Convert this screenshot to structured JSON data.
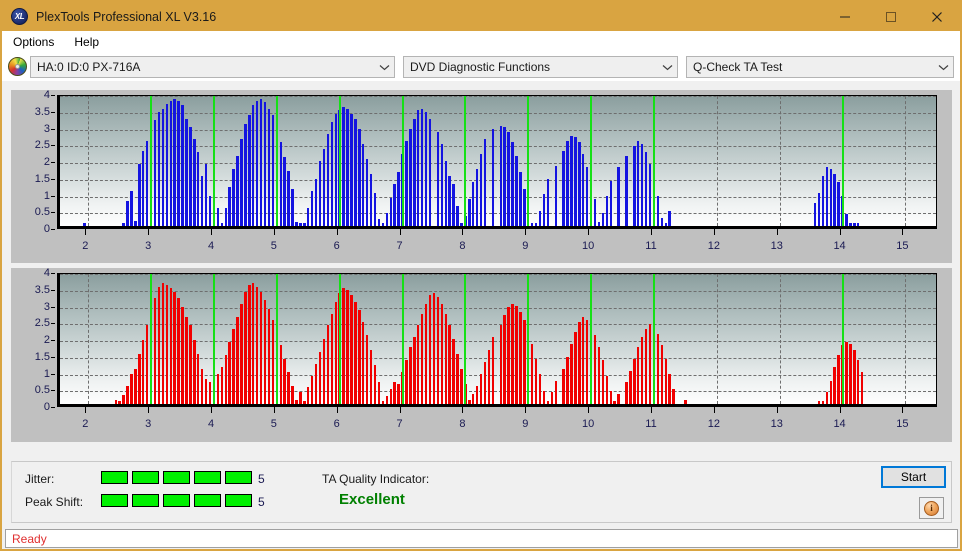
{
  "window": {
    "title": "PlexTools Professional XL V3.16",
    "app_icon": "xl-logo-icon",
    "minimize_label": "minimize-icon",
    "maximize_label": "maximize-icon",
    "close_label": "close-icon",
    "titlebar_color": "#d9a441"
  },
  "menu": {
    "items": [
      {
        "label": "Options"
      },
      {
        "label": "Help"
      }
    ]
  },
  "toolbar": {
    "drive_icon": "disc-icon",
    "drive_select": {
      "value": "HA:0 ID:0  PX-716A",
      "options": [
        "HA:0 ID:0  PX-716A"
      ]
    },
    "function_select": {
      "value": "DVD Diagnostic Functions",
      "options": [
        "DVD Diagnostic Functions"
      ]
    },
    "test_select": {
      "value": "Q-Check TA Test",
      "options": [
        "Q-Check TA Test"
      ]
    }
  },
  "results": {
    "jitter_label": "Jitter:",
    "jitter_value": "5",
    "jitter_segments_on": 5,
    "jitter_segments_total": 5,
    "peak_shift_label": "Peak Shift:",
    "peak_shift_value": "5",
    "peak_shift_segments_on": 5,
    "peak_shift_segments_total": 5,
    "ta_quality_label": "TA Quality Indicator:",
    "ta_quality_value": "Excellent",
    "ta_quality_color": "#008000",
    "meter_color": "#00f000",
    "start_button": "Start",
    "info_button": "i"
  },
  "status": {
    "text": "Ready",
    "color": "#e03030"
  },
  "chart_data": [
    {
      "type": "bar",
      "title": "Jitter TA distribution (top)",
      "series_name": "Jitter",
      "color": "#1414e0",
      "xlabel": "",
      "ylabel": "",
      "xlim": [
        1.55,
        15.55
      ],
      "ylim": [
        0,
        4
      ],
      "yticks": [
        0,
        0.5,
        1,
        1.5,
        2,
        2.5,
        3,
        3.5,
        4
      ],
      "xticks": [
        2,
        3,
        4,
        5,
        6,
        7,
        8,
        9,
        10,
        11,
        12,
        13,
        14,
        15
      ],
      "grid": true,
      "markers": [
        3,
        4,
        5,
        6,
        7,
        8,
        9,
        10,
        11,
        14
      ],
      "bar_step": 0.0625,
      "x": [
        1.9375,
        2.5625,
        2.625,
        2.6875,
        2.75,
        2.8125,
        2.875,
        2.9375,
        3.0,
        3.0625,
        3.125,
        3.1875,
        3.25,
        3.3125,
        3.375,
        3.4375,
        3.5,
        3.5625,
        3.625,
        3.6875,
        3.75,
        3.8125,
        3.875,
        3.9375,
        4.0,
        4.0625,
        4.125,
        4.1875,
        4.25,
        4.3125,
        4.375,
        4.4375,
        4.5,
        4.5625,
        4.625,
        4.6875,
        4.75,
        4.8125,
        4.875,
        4.9375,
        5.0,
        5.0625,
        5.125,
        5.1875,
        5.25,
        5.3125,
        5.375,
        5.4375,
        5.5,
        5.5625,
        5.625,
        5.6875,
        5.75,
        5.8125,
        5.875,
        5.9375,
        6.0,
        6.0625,
        6.125,
        6.1875,
        6.25,
        6.3125,
        6.375,
        6.4375,
        6.5,
        6.5625,
        6.625,
        6.6875,
        6.75,
        6.8125,
        6.875,
        6.9375,
        7.0,
        7.0625,
        7.125,
        7.1875,
        7.25,
        7.3125,
        7.375,
        7.4375,
        7.5625,
        7.625,
        7.6875,
        7.75,
        7.8125,
        7.875,
        7.9375,
        8.0,
        8.0625,
        8.125,
        8.1875,
        8.25,
        8.3125,
        8.4375,
        8.5625,
        8.625,
        8.6875,
        8.75,
        8.8125,
        8.875,
        8.9375,
        9.0,
        9.0625,
        9.125,
        9.1875,
        9.25,
        9.3125,
        9.4375,
        9.5625,
        9.625,
        9.6875,
        9.75,
        9.8125,
        9.875,
        9.9375,
        10.0,
        10.0625,
        10.125,
        10.1875,
        10.25,
        10.3125,
        10.4375,
        10.5625,
        10.6875,
        10.75,
        10.8125,
        10.875,
        10.9375,
        11.0,
        11.0625,
        11.125,
        11.1875,
        11.25,
        13.5625,
        13.625,
        13.6875,
        13.75,
        13.8125,
        13.875,
        13.9375,
        14.0,
        14.0625,
        14.125,
        14.1875,
        14.25
      ],
      "values": [
        0.08,
        0.1,
        0.75,
        1.05,
        0.14,
        1.85,
        2.25,
        2.55,
        2.95,
        3.15,
        3.4,
        3.5,
        3.65,
        3.72,
        3.78,
        3.74,
        3.6,
        3.2,
        2.95,
        2.6,
        2.2,
        1.5,
        1.85,
        0.9,
        0.12,
        0.55,
        0.1,
        0.55,
        1.15,
        1.7,
        2.1,
        2.6,
        3.05,
        3.3,
        3.6,
        3.72,
        3.78,
        3.7,
        3.5,
        3.3,
        2.9,
        2.5,
        2.05,
        1.65,
        1.1,
        0.12,
        0.1,
        0.08,
        0.55,
        1.05,
        1.4,
        1.95,
        2.3,
        2.75,
        3.1,
        3.35,
        3.45,
        3.55,
        3.5,
        3.35,
        3.2,
        2.9,
        2.45,
        2.0,
        1.55,
        1.0,
        0.2,
        0.1,
        0.38,
        0.85,
        1.25,
        1.6,
        2.15,
        2.55,
        2.9,
        3.2,
        3.45,
        3.5,
        3.4,
        3.2,
        2.8,
        2.45,
        1.95,
        1.5,
        1.25,
        0.6,
        0.1,
        0.3,
        0.8,
        1.3,
        1.7,
        2.15,
        2.6,
        2.9,
        3.0,
        2.95,
        2.8,
        2.5,
        2.1,
        1.6,
        1.1,
        0.45,
        0.1,
        0.08,
        0.45,
        0.95,
        1.4,
        1.8,
        2.25,
        2.55,
        2.7,
        2.65,
        2.5,
        2.15,
        1.75,
        1.3,
        0.8,
        0.12,
        0.4,
        0.9,
        1.35,
        1.75,
        2.1,
        2.4,
        2.55,
        2.45,
        2.2,
        1.85,
        1.4,
        0.9,
        0.25,
        0.1,
        0.45,
        0.7,
        1.0,
        1.5,
        1.75,
        1.7,
        1.55,
        1.3,
        0.9,
        0.35,
        0.1,
        0.08,
        0.1,
        0.35,
        0.85,
        1.35,
        1.6,
        1.8,
        1.72,
        1.5,
        1.15,
        0.7,
        0.2,
        0.08
      ]
    },
    {
      "type": "bar",
      "title": "Peak Shift TA distribution (bottom)",
      "series_name": "Peak Shift",
      "color": "#f00000",
      "xlabel": "",
      "ylabel": "",
      "xlim": [
        1.55,
        15.55
      ],
      "ylim": [
        0,
        4
      ],
      "yticks": [
        0,
        0.5,
        1,
        1.5,
        2,
        2.5,
        3,
        3.5,
        4
      ],
      "xticks": [
        2,
        3,
        4,
        5,
        6,
        7,
        8,
        9,
        10,
        11,
        12,
        13,
        14,
        15
      ],
      "grid": true,
      "markers": [
        3,
        4,
        5,
        6,
        7,
        8,
        9,
        10,
        11,
        14
      ],
      "bar_step": 0.0625,
      "x": [
        2.4375,
        2.5,
        2.5625,
        2.625,
        2.6875,
        2.75,
        2.8125,
        2.875,
        2.9375,
        3.0,
        3.0625,
        3.125,
        3.1875,
        3.25,
        3.3125,
        3.375,
        3.4375,
        3.5,
        3.5625,
        3.625,
        3.6875,
        3.75,
        3.8125,
        3.875,
        3.9375,
        4.0,
        4.0625,
        4.125,
        4.1875,
        4.25,
        4.3125,
        4.375,
        4.4375,
        4.5,
        4.5625,
        4.625,
        4.6875,
        4.75,
        4.8125,
        4.875,
        4.9375,
        5.0,
        5.0625,
        5.125,
        5.1875,
        5.25,
        5.3125,
        5.375,
        5.4375,
        5.5,
        5.5625,
        5.625,
        5.6875,
        5.75,
        5.8125,
        5.875,
        5.9375,
        6.0,
        6.0625,
        6.125,
        6.1875,
        6.25,
        6.3125,
        6.375,
        6.4375,
        6.5,
        6.5625,
        6.625,
        6.6875,
        6.75,
        6.8125,
        6.875,
        6.9375,
        7.0,
        7.0625,
        7.125,
        7.1875,
        7.25,
        7.3125,
        7.375,
        7.4375,
        7.5,
        7.5625,
        7.625,
        7.6875,
        7.75,
        7.8125,
        7.875,
        7.9375,
        8.0,
        8.0625,
        8.125,
        8.1875,
        8.25,
        8.3125,
        8.375,
        8.4375,
        8.5625,
        8.625,
        8.6875,
        8.75,
        8.8125,
        8.875,
        8.9375,
        9.0,
        9.0625,
        9.125,
        9.1875,
        9.25,
        9.3125,
        9.375,
        9.4375,
        9.5625,
        9.625,
        9.6875,
        9.75,
        9.8125,
        9.875,
        9.9375,
        10.0,
        10.0625,
        10.125,
        10.1875,
        10.25,
        10.3125,
        10.375,
        10.4375,
        10.5625,
        10.625,
        10.6875,
        10.75,
        10.8125,
        10.875,
        10.9375,
        11.0,
        11.0625,
        11.125,
        11.1875,
        11.25,
        11.3125,
        11.5,
        13.625,
        13.6875,
        13.75,
        13.8125,
        13.875,
        13.9375,
        14.0,
        14.0625,
        14.125,
        14.1875,
        14.25,
        14.3125
      ],
      "values": [
        0.12,
        0.1,
        0.28,
        0.55,
        0.9,
        1.05,
        1.5,
        1.9,
        2.35,
        2.7,
        3.15,
        3.5,
        3.62,
        3.55,
        3.45,
        3.35,
        3.15,
        2.9,
        2.6,
        2.35,
        1.9,
        1.5,
        1.05,
        0.75,
        0.65,
        0.7,
        0.9,
        1.1,
        1.45,
        1.85,
        2.25,
        2.6,
        3.0,
        3.35,
        3.55,
        3.62,
        3.5,
        3.35,
        3.1,
        2.85,
        2.5,
        2.2,
        1.75,
        1.35,
        0.95,
        0.55,
        0.12,
        0.35,
        0.1,
        0.5,
        0.85,
        1.2,
        1.55,
        1.95,
        2.35,
        2.7,
        3.05,
        3.3,
        3.45,
        3.4,
        3.25,
        3.05,
        2.8,
        2.45,
        2.05,
        1.6,
        1.15,
        0.65,
        0.1,
        0.25,
        0.45,
        0.65,
        0.6,
        0.95,
        1.3,
        1.7,
        2.0,
        2.35,
        2.7,
        3.0,
        3.25,
        3.3,
        3.2,
        3.0,
        2.7,
        2.35,
        1.95,
        1.5,
        1.05,
        0.6,
        0.12,
        0.3,
        0.55,
        0.9,
        1.25,
        1.6,
        2.0,
        2.35,
        2.65,
        2.9,
        3.0,
        2.92,
        2.75,
        2.5,
        2.2,
        1.8,
        1.35,
        0.9,
        0.4,
        0.1,
        0.35,
        0.7,
        1.05,
        1.4,
        1.8,
        2.15,
        2.45,
        2.6,
        2.52,
        2.35,
        2.05,
        1.7,
        1.3,
        0.85,
        0.4,
        0.1,
        0.3,
        0.65,
        1.0,
        1.35,
        1.7,
        2.0,
        2.25,
        2.4,
        2.3,
        2.1,
        1.75,
        1.35,
        0.9,
        0.45,
        0.12,
        0.1,
        0.1,
        0.35,
        0.7,
        1.1,
        1.45,
        1.75,
        1.85,
        1.78,
        1.6,
        1.3,
        0.95,
        0.55,
        0.2
      ]
    }
  ]
}
